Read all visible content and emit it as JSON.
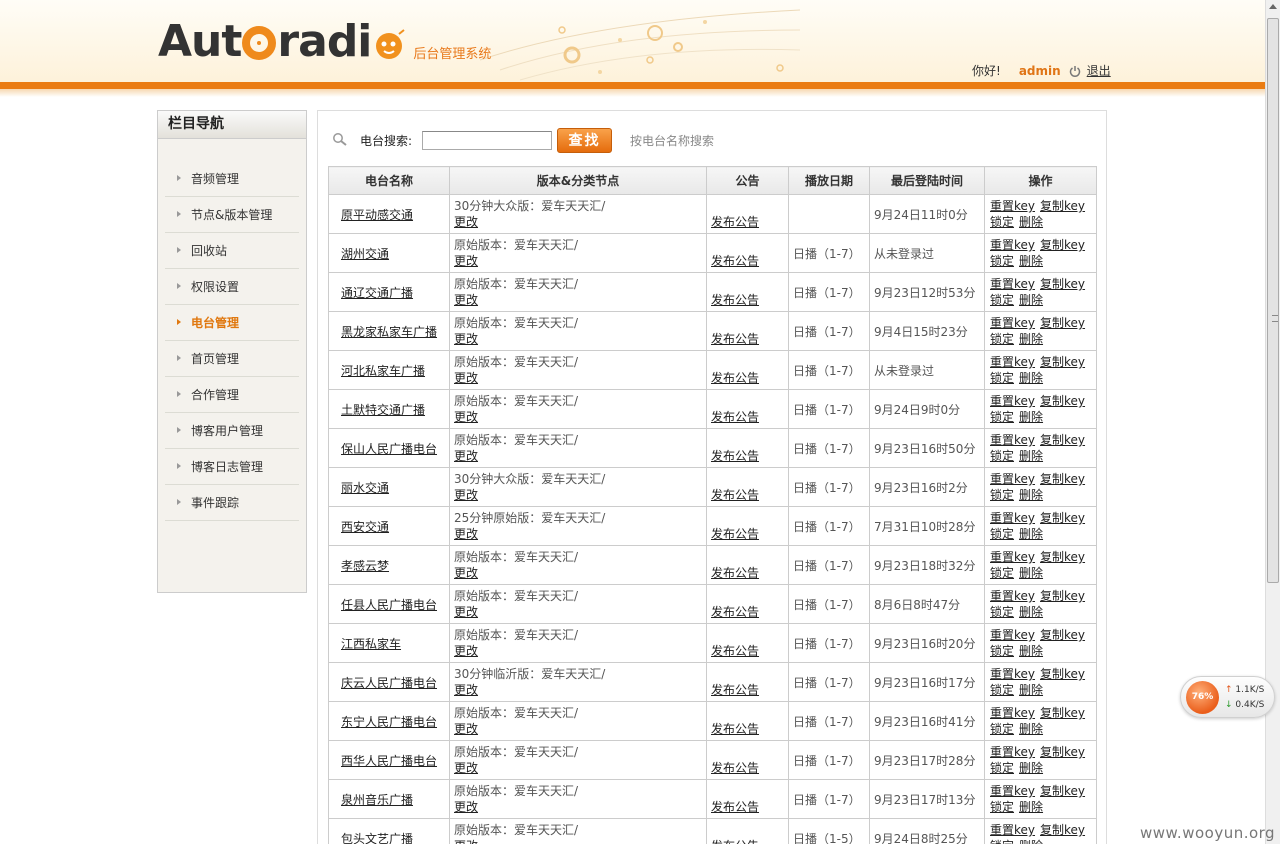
{
  "header": {
    "logo_text": "Autoradi",
    "subtitle": "后台管理系统",
    "greeting": "你好!",
    "username": "admin",
    "logout_label": "退出"
  },
  "sidebar": {
    "title": "栏目导航",
    "items": [
      {
        "label": "音频管理"
      },
      {
        "label": "节点&版本管理"
      },
      {
        "label": "回收站"
      },
      {
        "label": "权限设置"
      },
      {
        "label": "电台管理",
        "active": true
      },
      {
        "label": "首页管理"
      },
      {
        "label": "合作管理"
      },
      {
        "label": "博客用户管理"
      },
      {
        "label": "博客日志管理"
      },
      {
        "label": "事件跟踪"
      }
    ]
  },
  "search": {
    "label": "电台搜索:",
    "value": "",
    "button_label": "查找",
    "hint": "按电台名称搜索"
  },
  "table": {
    "headers": [
      "电台名称",
      "版本&分类节点",
      "公告",
      "播放日期",
      "最后登陆时间",
      "操作"
    ],
    "edit_label": "更改",
    "notice_label": "发布公告",
    "ops": {
      "reset_key": "重置key",
      "copy_key": "复制key",
      "lock": "锁定",
      "delete": "删除"
    },
    "rows": [
      {
        "name": "原平动感交通",
        "version": "30分钟大众版：爱车天天汇/",
        "play": "",
        "login": "9月24日11时0分"
      },
      {
        "name": "湖州交通",
        "version": "原始版本：爱车天天汇/",
        "play": "日播（1-7）",
        "login": "从未登录过"
      },
      {
        "name": "通辽交通广播",
        "version": "原始版本：爱车天天汇/",
        "play": "日播（1-7）",
        "login": "9月23日12时53分"
      },
      {
        "name": "黑龙家私家车广播",
        "version": "原始版本：爱车天天汇/",
        "play": "日播（1-7）",
        "login": "9月4日15时23分"
      },
      {
        "name": "河北私家车广播",
        "version": "原始版本：爱车天天汇/",
        "play": "日播（1-7）",
        "login": "从未登录过"
      },
      {
        "name": "土默特交通广播",
        "version": "原始版本：爱车天天汇/",
        "play": "日播（1-7）",
        "login": "9月24日9时0分"
      },
      {
        "name": "保山人民广播电台",
        "version": "原始版本：爱车天天汇/",
        "play": "日播（1-7）",
        "login": "9月23日16时50分"
      },
      {
        "name": "丽水交通",
        "version": "30分钟大众版：爱车天天汇/",
        "play": "日播（1-7）",
        "login": "9月23日16时2分"
      },
      {
        "name": "西安交通",
        "version": "25分钟原始版：爱车天天汇/",
        "play": "日播（1-7）",
        "login": "7月31日10时28分"
      },
      {
        "name": "孝感云梦",
        "version": "原始版本：爱车天天汇/",
        "play": "日播（1-7）",
        "login": "9月23日18时32分"
      },
      {
        "name": "任县人民广播电台",
        "version": "原始版本：爱车天天汇/",
        "play": "日播（1-7）",
        "login": "8月6日8时47分"
      },
      {
        "name": "江西私家车",
        "version": "原始版本：爱车天天汇/",
        "play": "日播（1-7）",
        "login": "9月23日16时20分"
      },
      {
        "name": "庆云人民广播电台",
        "version": "30分钟临沂版：爱车天天汇/",
        "play": "日播（1-7）",
        "login": "9月23日16时17分"
      },
      {
        "name": "东宁人民广播电台",
        "version": "原始版本：爱车天天汇/",
        "play": "日播（1-7）",
        "login": "9月23日16时41分"
      },
      {
        "name": "西华人民广播电台",
        "version": "原始版本：爱车天天汇/",
        "play": "日播（1-7）",
        "login": "9月23日17时28分"
      },
      {
        "name": "泉州音乐广播",
        "version": "原始版本：爱车天天汇/",
        "play": "日播（1-7）",
        "login": "9月23日17时13分"
      },
      {
        "name": "包头文艺广播",
        "version": "原始版本：爱车天天汇/",
        "play": "日播（1-5）",
        "login": "9月24日8时25分"
      }
    ]
  },
  "net_widget": {
    "percent": "76%",
    "up": "1.1K/S",
    "down": "0.4K/S"
  },
  "watermark": "www.wooyun.org"
}
